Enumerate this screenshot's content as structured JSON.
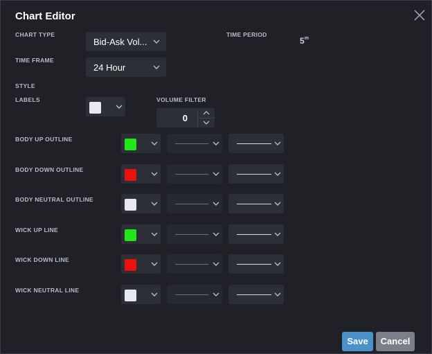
{
  "dialog": {
    "title": "Chart Editor"
  },
  "chart_type": {
    "label": "CHART TYPE",
    "value": "Bid-Ask Vol..."
  },
  "time_period": {
    "label": "TIME PERIOD",
    "value": "5",
    "unit": "m"
  },
  "time_frame": {
    "label": "TIME FRAME",
    "value": "24 Hour"
  },
  "style": {
    "label": "STYLE"
  },
  "labels": {
    "label": "LABELS",
    "color": "#e8e9ee"
  },
  "volume_filter": {
    "label": "VOLUME FILTER",
    "value": "0"
  },
  "rows": [
    {
      "label": "BODY UP OUTLINE",
      "color": "#22e81a"
    },
    {
      "label": "BODY DOWN OUTLINE",
      "color": "#e8120e"
    },
    {
      "label": "BODY NEUTRAL OUTLINE",
      "color": "#e8e9ee"
    },
    {
      "label": "WICK UP LINE",
      "color": "#22e81a"
    },
    {
      "label": "WICK DOWN LINE",
      "color": "#e8120e"
    },
    {
      "label": "WICK NEUTRAL LINE",
      "color": "#e8e9ee"
    }
  ],
  "buttons": {
    "save": "Save",
    "cancel": "Cancel"
  },
  "icons": {
    "close": "close-icon",
    "dropdown": "chevron-down-icon"
  }
}
